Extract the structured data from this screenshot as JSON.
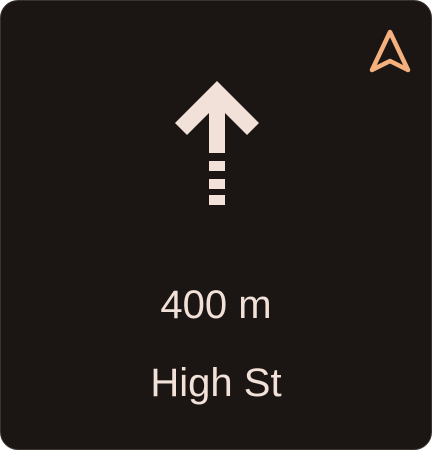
{
  "navigation": {
    "icon": "navigation-arrow-icon",
    "maneuver_icon": "straight-arrow-icon",
    "distance": "400 m",
    "street": "High St"
  },
  "colors": {
    "background": "#1b1613",
    "text": "#f1e1d8",
    "accent": "#f5b17d"
  }
}
